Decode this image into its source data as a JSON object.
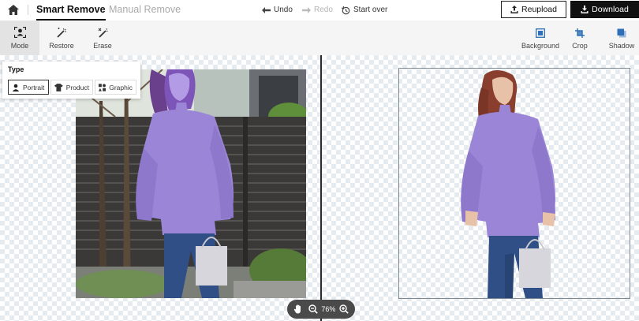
{
  "header": {
    "tabs": [
      {
        "label": "Smart Remove",
        "active": true
      },
      {
        "label": "Manual Remove",
        "active": false
      }
    ],
    "undo_label": "Undo",
    "redo_label": "Redo",
    "start_over_label": "Start over",
    "reupload_label": "Reupload",
    "download_label": "Download"
  },
  "toolbar": {
    "left_tools": [
      {
        "label": "Mode",
        "icon": "person-frame-icon",
        "active": true
      },
      {
        "label": "Restore",
        "icon": "wand-restore-icon"
      },
      {
        "label": "Erase",
        "icon": "wand-erase-icon"
      }
    ],
    "right_tools": [
      {
        "label": "Background",
        "icon": "background-icon"
      },
      {
        "label": "Crop",
        "icon": "crop-icon"
      },
      {
        "label": "Shadow",
        "icon": "shadow-icon"
      }
    ]
  },
  "type_panel": {
    "title": "Type",
    "options": [
      {
        "label": "Portrait",
        "selected": true
      },
      {
        "label": "Product",
        "selected": false
      },
      {
        "label": "Graphic",
        "selected": false
      }
    ]
  },
  "zoom": {
    "value": "76%"
  },
  "colors": {
    "accent": "#111111",
    "sweater": "#9a85d6",
    "jeans": "#2f4f86",
    "disabled": "#b4b4b4"
  }
}
